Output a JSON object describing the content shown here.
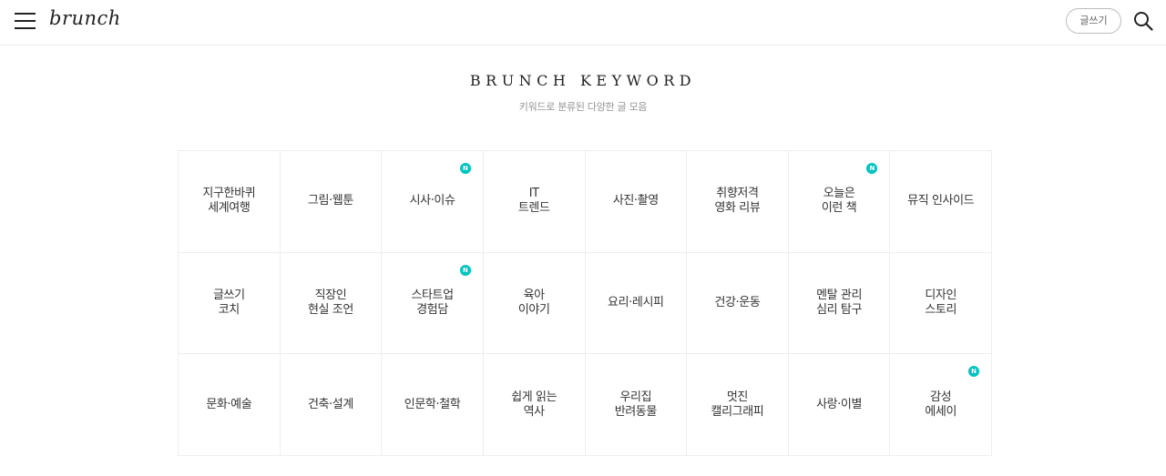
{
  "header": {
    "logo": "brunch",
    "write_label": "글쓰기"
  },
  "section": {
    "title": "BRUNCH KEYWORD",
    "subtitle": "키워드로 분류된 다양한 글 모음"
  },
  "badge_label": "N",
  "keywords": [
    {
      "label": "지구한바퀴\n세계여행",
      "is_new": false
    },
    {
      "label": "그림·웹툰",
      "is_new": false
    },
    {
      "label": "시사·이슈",
      "is_new": true
    },
    {
      "label": "IT\n트렌드",
      "is_new": false
    },
    {
      "label": "사진·촬영",
      "is_new": false
    },
    {
      "label": "취향저격\n영화 리뷰",
      "is_new": false
    },
    {
      "label": "오늘은\n이런 책",
      "is_new": true
    },
    {
      "label": "뮤직 인사이드",
      "is_new": false
    },
    {
      "label": "글쓰기\n코치",
      "is_new": false
    },
    {
      "label": "직장인\n현실 조언",
      "is_new": false
    },
    {
      "label": "스타트업\n경험담",
      "is_new": true
    },
    {
      "label": "육아\n이야기",
      "is_new": false
    },
    {
      "label": "요리·레시피",
      "is_new": false
    },
    {
      "label": "건강·운동",
      "is_new": false
    },
    {
      "label": "멘탈 관리\n심리 탐구",
      "is_new": false
    },
    {
      "label": "디자인\n스토리",
      "is_new": false
    },
    {
      "label": "문화·예술",
      "is_new": false
    },
    {
      "label": "건축·설계",
      "is_new": false
    },
    {
      "label": "인문학·철학",
      "is_new": false
    },
    {
      "label": "쉽게 읽는\n역사",
      "is_new": false
    },
    {
      "label": "우리집\n반려동물",
      "is_new": false
    },
    {
      "label": "멋진\n캘리그래피",
      "is_new": false
    },
    {
      "label": "사랑·이별",
      "is_new": false
    },
    {
      "label": "감성\n에세이",
      "is_new": true
    }
  ],
  "colors": {
    "badge": "#00c3bd",
    "border": "#eeeeee",
    "text": "#333333",
    "subtitle": "#959595"
  }
}
